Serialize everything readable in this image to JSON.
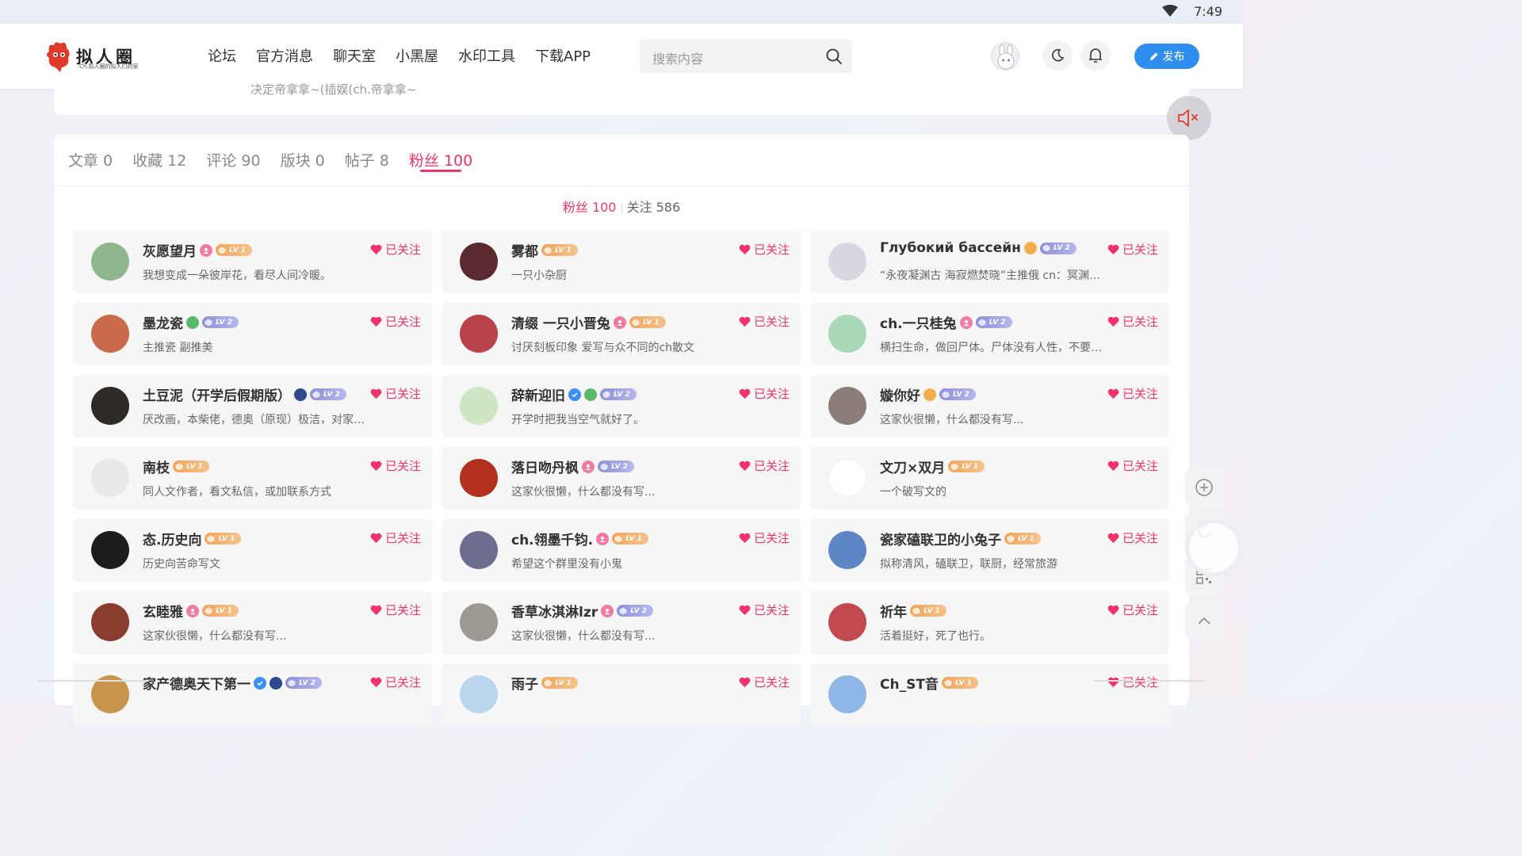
{
  "status": {
    "time": "7:49"
  },
  "header": {
    "logo_text": "拟人圈",
    "logo_tagline": "Ch.拟人圈的拟人们的家",
    "nav": [
      "论坛",
      "官方消息",
      "聊天室",
      "小黑屋",
      "水印工具",
      "下载APP"
    ],
    "search_placeholder": "搜索内容",
    "publish_label": "发布"
  },
  "prev_card_text": "决定帝拿拿~(插娱(ch.帝拿拿~",
  "tabs": [
    {
      "label": "文章 0",
      "active": false
    },
    {
      "label": "收藏 12",
      "active": false
    },
    {
      "label": "评论 90",
      "active": false
    },
    {
      "label": "版块 0",
      "active": false
    },
    {
      "label": "帖子 8",
      "active": false
    },
    {
      "label": "粉丝 100",
      "active": true
    }
  ],
  "subtabs": {
    "fans": "粉丝 100",
    "following": "关注 586"
  },
  "follow_label": "已关注",
  "level_labels": {
    "lv1": "LV 1",
    "lv2": "LV 2"
  },
  "users": [
    {
      "name": "灰愿望月",
      "badges": [
        "pink"
      ],
      "level": "lv1",
      "bio": "我想变成一朵彼岸花，看尽人间冷暖。",
      "avatar_bg": "#8fb78e"
    },
    {
      "name": "雾都",
      "badges": [],
      "level": "lv1",
      "bio": "一只小杂厨",
      "avatar_bg": "#5a2a2e"
    },
    {
      "name": "Глубокий бассейн",
      "badges": [
        "orange"
      ],
      "level": "lv2",
      "bio": "“永夜凝渊古 海寂燃焚晓”主推俄 cn：冥渊 废人一…",
      "avatar_bg": "#d9d6e4"
    },
    {
      "name": "墨龙瓷",
      "badges": [
        "green"
      ],
      "level": "lv2",
      "bio": "主推瓷 副推美",
      "avatar_bg": "#c96b4a"
    },
    {
      "name": "清缀 一只小晋兔",
      "badges": [
        "pink"
      ],
      "level": "lv1",
      "bio": "讨厌刻板印象 爱写与众不同的ch散文",
      "avatar_bg": "#b8434a"
    },
    {
      "name": "ch.一只桂兔",
      "badges": [
        "pink"
      ],
      "level": "lv2",
      "bio": "横扫生命，做回尸体。尸体没有人性，不要虐尸，…",
      "avatar_bg": "#a8d8b8"
    },
    {
      "name": "土豆泥（开学后假期版）",
      "badges": [
        "navy"
      ],
      "level": "lv2",
      "bio": "厌改画，本柴佬，德奥（原现）极洁，对家别来（…",
      "avatar_bg": "#2e2a26"
    },
    {
      "name": "辞新迎旧",
      "badges": [
        "blue",
        "green"
      ],
      "level": "lv2",
      "bio": "开学时把我当空气就好了。",
      "avatar_bg": "#cfe6c4"
    },
    {
      "name": "嫙你好",
      "badges": [
        "orange"
      ],
      "level": "lv2",
      "bio": "这家伙很懒，什么都没有写...",
      "avatar_bg": "#8b7e78"
    },
    {
      "name": "南枝",
      "badges": [],
      "level": "lv1",
      "bio": "同人文作者，看文私信，或加联系方式",
      "avatar_bg": "#e8e8e8"
    },
    {
      "name": "落日吻丹枫",
      "badges": [
        "pink"
      ],
      "level": "lv2",
      "bio": "这家伙很懒，什么都没有写...",
      "avatar_bg": "#b4301e"
    },
    {
      "name": "文刀×双月",
      "badges": [],
      "level": "lv1",
      "bio": "一个破写文的",
      "avatar_bg": "#ffffff"
    },
    {
      "name": "态.历史向",
      "badges": [],
      "level": "lv1",
      "bio": "历史向苦命写文",
      "avatar_bg": "#1e1c1c"
    },
    {
      "name": "ch.翎墨千钧.",
      "badges": [
        "pink"
      ],
      "level": "lv1",
      "bio": "希望这个群里没有小鬼",
      "avatar_bg": "#6b6c8e"
    },
    {
      "name": "瓷家磕联卫的小兔子",
      "badges": [],
      "level": "lv1",
      "bio": "拟称清风，磕联卫，联厨，经常旅游",
      "avatar_bg": "#5f86c4"
    },
    {
      "name": "玄睦雅",
      "badges": [
        "pink"
      ],
      "level": "lv1",
      "bio": "这家伙很懒，什么都没有写...",
      "avatar_bg": "#8a3c2e"
    },
    {
      "name": "香草冰淇淋lzr",
      "badges": [
        "pink"
      ],
      "level": "lv2",
      "bio": "这家伙很懒，什么都没有写...",
      "avatar_bg": "#9c9a92"
    },
    {
      "name": "祈年",
      "badges": [],
      "level": "lv1",
      "bio": "活着挺好，死了也行。",
      "avatar_bg": "#c24a4e"
    },
    {
      "name": "家产德奥天下第一",
      "badges": [
        "blue",
        "navy"
      ],
      "level": "lv2",
      "bio": "",
      "avatar_bg": "#c7944e"
    },
    {
      "name": "雨子",
      "badges": [],
      "level": "lv1",
      "bio": "",
      "avatar_bg": "#bcd6f0"
    },
    {
      "name": "Ch_ST音",
      "badges": [],
      "level": "lv1",
      "bio": "",
      "avatar_bg": "#8fb4e6"
    }
  ],
  "colors": {
    "accent": "#f2336a",
    "publish": "#2e8ef0"
  }
}
